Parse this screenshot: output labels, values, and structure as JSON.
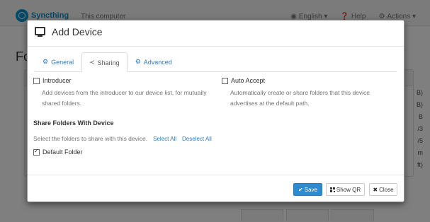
{
  "background": {
    "brand": "Syncthing",
    "device_name": "This computer",
    "nav": [
      {
        "icon": "globe-icon",
        "glyph": "◉",
        "label": "English ▾"
      },
      {
        "icon": "help-icon",
        "glyph": "❓",
        "label": "Help"
      },
      {
        "icon": "gear-icon",
        "glyph": "⚙",
        "label": "Actions ▾"
      }
    ],
    "heading": "Fo",
    "right_fragments": [
      "B)",
      "B)",
      "B",
      "/3",
      "/5",
      "m",
      "ft)"
    ]
  },
  "modal": {
    "title": "Add Device",
    "tabs": [
      {
        "label": "General",
        "icon": "gear-icon",
        "glyph": "⚙",
        "active": false
      },
      {
        "label": "Sharing",
        "icon": "share-icon",
        "glyph": "≺",
        "active": true
      },
      {
        "label": "Advanced",
        "icon": "cogs-icon",
        "glyph": "⚙",
        "active": false
      }
    ],
    "introducer": {
      "label": "Introducer",
      "checked": false,
      "help": "Add devices from the introducer to our device list, for mutually shared folders."
    },
    "auto_accept": {
      "label": "Auto Accept",
      "checked": false,
      "help": "Automatically create or share folders that this device advertises at the default path."
    },
    "share_section": {
      "title": "Share Folders With Device",
      "description": "Select the folders to share with this device.",
      "select_all": "Select All",
      "deselect_all": "Deselect All"
    },
    "folders": [
      {
        "label": "Default Folder",
        "checked": true
      }
    ],
    "footer": {
      "save": "Save",
      "show_qr": "Show QR",
      "close": "Close"
    }
  },
  "colors": {
    "accent": "#337ab7",
    "brand": "#0891d1",
    "primary_button": "#2d8bd0"
  }
}
